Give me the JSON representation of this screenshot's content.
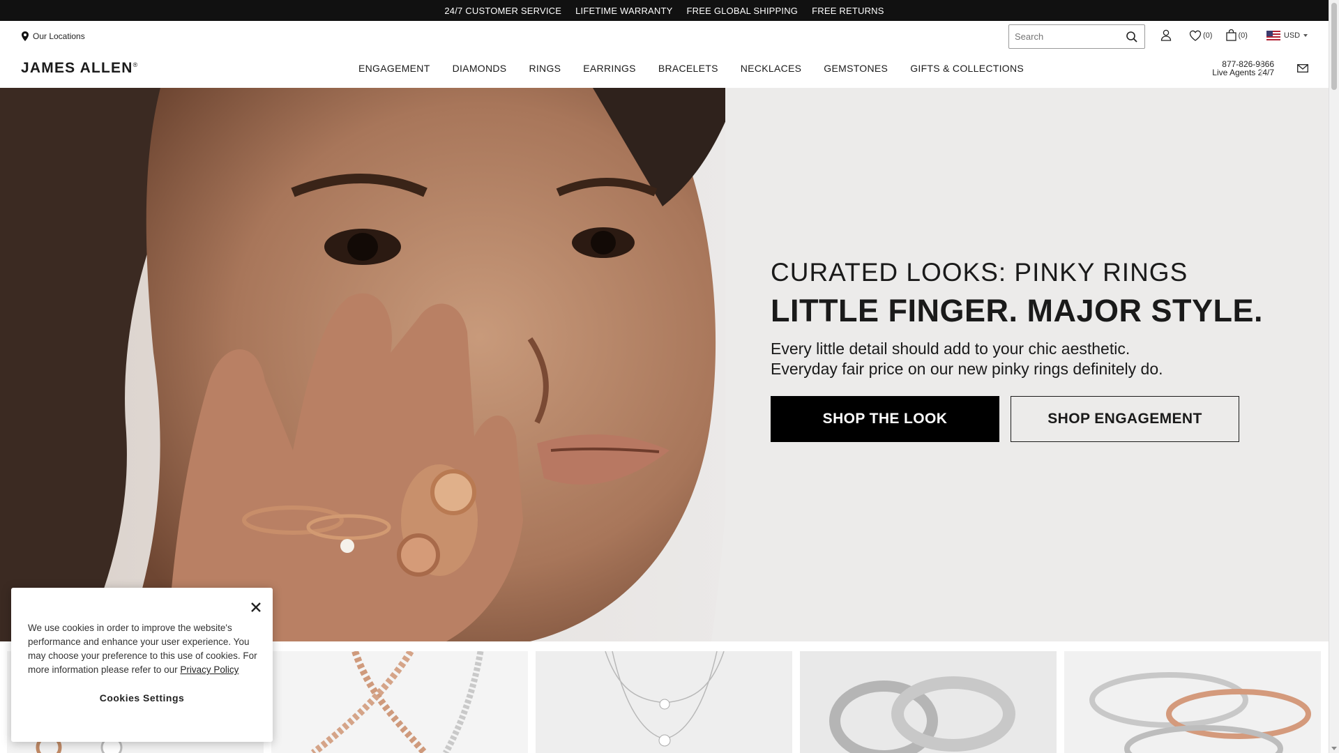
{
  "promo_bar": {
    "items": [
      "24/7 CUSTOMER SERVICE",
      "LIFETIME WARRANTY",
      "FREE GLOBAL SHIPPING",
      "FREE RETURNS"
    ]
  },
  "header": {
    "locations_label": "Our Locations",
    "logo": "JAMES ALLEN",
    "logo_mark": "®",
    "search_placeholder": "Search",
    "wishlist_count": "(0)",
    "cart_count": "(0)",
    "currency": "USD",
    "phone": "877-826-9866",
    "phone_sub": "Live Agents 24/7"
  },
  "nav": {
    "items": [
      "ENGAGEMENT",
      "DIAMONDS",
      "RINGS",
      "EARRINGS",
      "BRACELETS",
      "NECKLACES",
      "GEMSTONES",
      "GIFTS & COLLECTIONS"
    ]
  },
  "hero": {
    "eyebrow": "CURATED LOOKS: PINKY RINGS",
    "headline": "LITTLE FINGER. MAJOR STYLE.",
    "sub_line1": "Every little detail should add to your chic aesthetic.",
    "sub_line2": "Everyday fair price on our new pinky rings definitely do.",
    "cta_primary": "SHOP THE LOOK",
    "cta_secondary": "SHOP ENGAGEMENT"
  },
  "cookie_banner": {
    "text": "We use cookies in order to improve the website's performance and enhance your user experience. You may choose your preference to this use of cookies. For more information please refer to our ",
    "link": "Privacy Policy",
    "settings_label": "Cookies Settings"
  },
  "colors": {
    "promo_bg": "#111111",
    "hero_bg": "#ebe9e8",
    "button_primary": "#000000"
  }
}
